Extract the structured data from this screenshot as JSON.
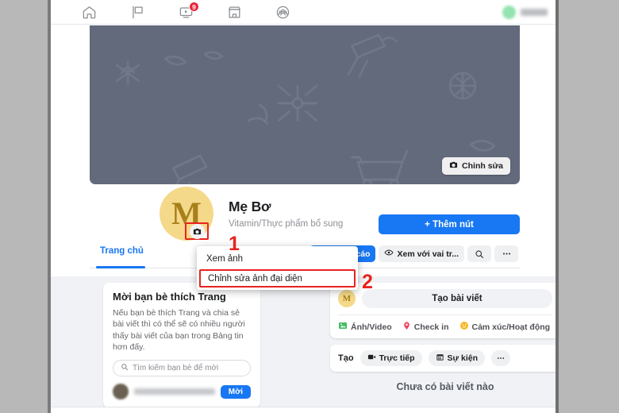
{
  "topnav": {
    "icons": [
      {
        "name": "home-icon",
        "label": "Trang chủ"
      },
      {
        "name": "flag-icon",
        "label": "Trang"
      },
      {
        "name": "video-icon",
        "label": "Video",
        "badge": "9"
      },
      {
        "name": "marketplace-icon",
        "label": "Marketplace"
      },
      {
        "name": "groups-icon",
        "label": "Nhóm"
      }
    ],
    "account": {
      "avatar_color": "#92e3ae",
      "name_blurred": true
    }
  },
  "cover": {
    "background_color": "#636a7c",
    "edit_label": "Chỉnh sửa",
    "edit_icon": "camera-icon"
  },
  "profile": {
    "avatar_letter": "M",
    "avatar_color": "#f5d98a",
    "avatar_text_color": "#a8801b",
    "camera_icon": "camera-icon",
    "name": "Mẹ Bơ",
    "category": "Vitamin/Thực phẩm bổ sung",
    "add_button_label": "+ Thêm nút",
    "add_button_color": "#1877f2"
  },
  "tabs": {
    "items": [
      {
        "label": "Trang chủ",
        "active": true
      }
    ],
    "actions": {
      "ads_label": "Quảng cáo",
      "ads_icon": "megaphone-icon",
      "view_as_label": "Xem với vai tr...",
      "view_as_icon": "eye-icon",
      "search_icon": "search-icon",
      "more_icon": "ellipsis-icon"
    }
  },
  "menu": {
    "items": [
      {
        "label": "Xem ảnh",
        "highlighted": false
      },
      {
        "label": "Chỉnh sửa ảnh đại diện",
        "highlighted": true
      }
    ]
  },
  "annotations": {
    "one": "1",
    "two": "2",
    "color": "#e8231f"
  },
  "left_card": {
    "title": "Mời bạn bè thích Trang",
    "body": "Nếu bạn bè thích Trang và chia sẻ bài viết thì có thể sẽ có nhiều người thấy bài viết của bạn trong Bảng tin hơn đấy.",
    "search_placeholder": "Tìm kiếm bạn bè để mời",
    "search_icon": "search-icon",
    "friend_row": {
      "name_blurred": true,
      "invite_label": "Mời"
    }
  },
  "composer": {
    "avatar_letter": "M",
    "placeholder": "Tạo bài viết",
    "actions": [
      {
        "label": "Ảnh/Video",
        "icon": "photo-video-icon",
        "color": "#45bd62"
      },
      {
        "label": "Check in",
        "icon": "location-pin-icon",
        "color": "#f3425f"
      },
      {
        "label": "Cảm xúc/Hoạt động",
        "icon": "smiley-icon",
        "color": "#f7b928"
      }
    ]
  },
  "create_row": {
    "label": "Tạo",
    "chips": [
      {
        "label": "Trực tiếp",
        "icon": "live-video-icon"
      },
      {
        "label": "Sự kiện",
        "icon": "calendar-icon"
      }
    ],
    "more_icon": "ellipsis-icon"
  },
  "feed": {
    "empty_message": "Chưa có bài viết nào"
  }
}
